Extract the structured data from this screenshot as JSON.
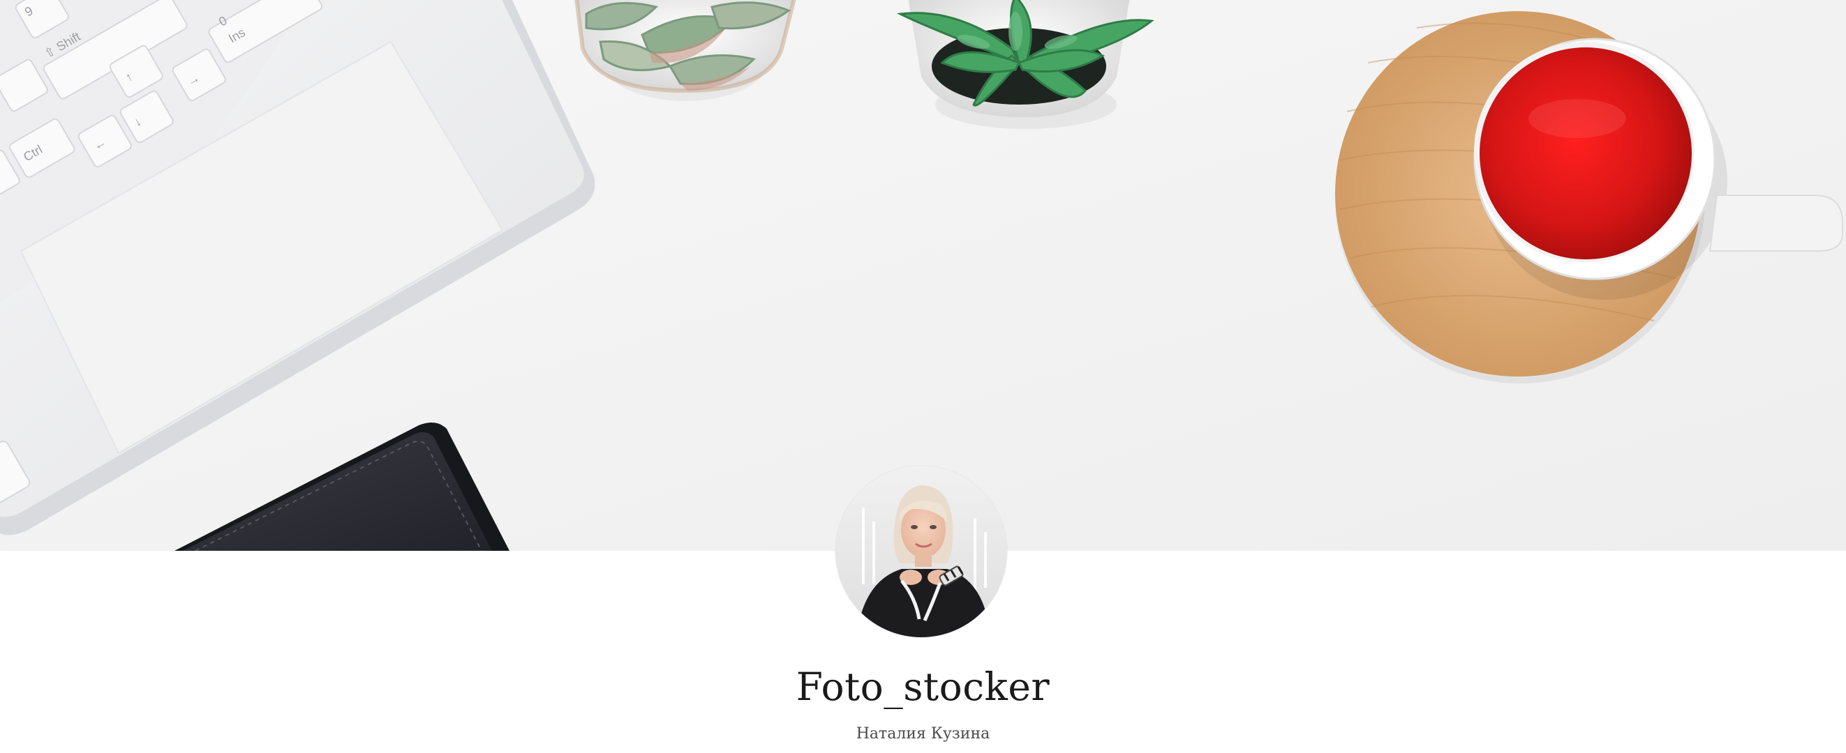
{
  "profile": {
    "name": "Foto_stocker",
    "subtitle": "Наталия Кузина"
  },
  "cover": {
    "keyboard_keys": {
      "shift": "⇧ Shift",
      "ins": "Ins",
      "ins_digit": "0",
      "ctrl": "Ctrl",
      "up": "↑",
      "down": "↓",
      "left": "←",
      "right": "→",
      "nine": "9"
    }
  },
  "colors": {
    "background": "#ffffff",
    "desk": "#f4f4f4",
    "tea": "#d41a1a",
    "coaster": "#d9a774",
    "succulent": "#3e9a57",
    "notebook": "#2c2d33"
  }
}
